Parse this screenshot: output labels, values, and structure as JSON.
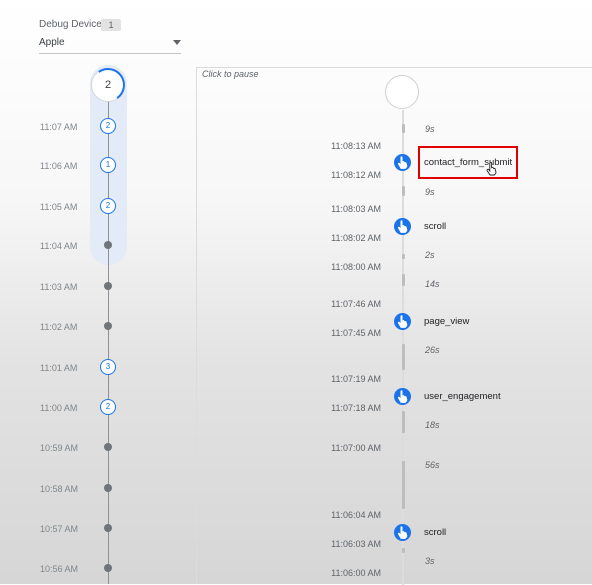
{
  "header": {
    "device_label": "Debug Device",
    "device_count": "1",
    "device_value": "Apple"
  },
  "minutes": {
    "top_count": "2",
    "rows": [
      {
        "time": "11:07 AM",
        "count": "2",
        "kind": "circle"
      },
      {
        "time": "11:06 AM",
        "count": "1",
        "kind": "circle"
      },
      {
        "time": "11:05 AM",
        "count": "2",
        "kind": "circle"
      },
      {
        "time": "11:04 AM",
        "count": "",
        "kind": "dot"
      },
      {
        "time": "11:03 AM",
        "count": "",
        "kind": "dot"
      },
      {
        "time": "11:02 AM",
        "count": "",
        "kind": "dot"
      },
      {
        "time": "11:01 AM",
        "count": "3",
        "kind": "circle"
      },
      {
        "time": "11:00 AM",
        "count": "2",
        "kind": "circle"
      },
      {
        "time": "10:59 AM",
        "count": "",
        "kind": "dot"
      },
      {
        "time": "10:58 AM",
        "count": "",
        "kind": "dot"
      },
      {
        "time": "10:57 AM",
        "count": "",
        "kind": "dot"
      },
      {
        "time": "10:56 AM",
        "count": "",
        "kind": "dot"
      }
    ]
  },
  "stream": {
    "pause_hint": "Click to pause",
    "gaps": [
      "9s",
      "9s",
      "2s",
      "14s",
      "26s",
      "18s",
      "56s",
      "3s"
    ],
    "times": [
      "11:08:13 AM",
      "11:08:12 AM",
      "11:08:03 AM",
      "11:08:02 AM",
      "11:08:00 AM",
      "11:07:46 AM",
      "11:07:45 AM",
      "11:07:19 AM",
      "11:07:18 AM",
      "11:07:00 AM",
      "11:06:04 AM",
      "11:06:03 AM",
      "11:06:00 AM"
    ],
    "events": [
      "contact_form_submit",
      "scroll",
      "page_view",
      "user_engagement",
      "scroll"
    ]
  },
  "colors": {
    "accent": "#1a73e8",
    "highlight": "#e2ebf7",
    "selection_outline": "#e00000"
  },
  "icons": {
    "event": "touch-hand-icon",
    "dropdown": "caret-down-icon",
    "pointer": "hand-pointer-cursor-icon"
  }
}
